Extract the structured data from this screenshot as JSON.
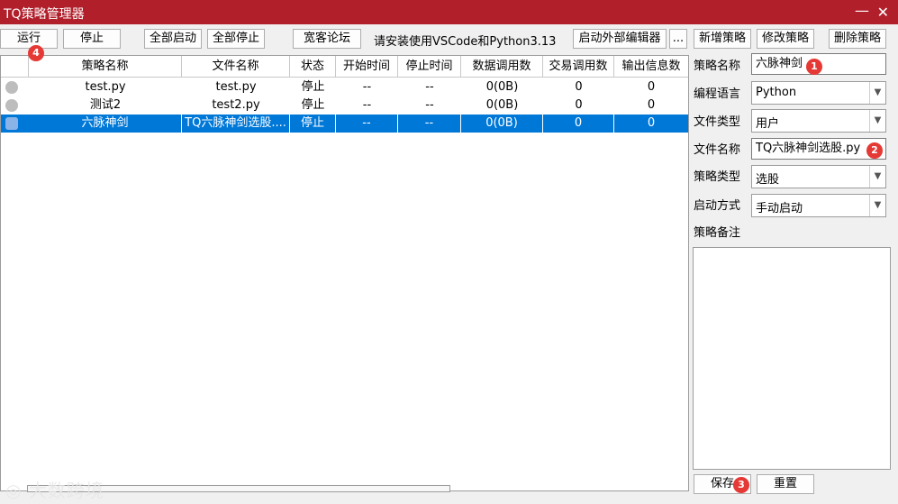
{
  "window": {
    "title": "TQ策略管理器",
    "minimize_glyph": "—",
    "close_glyph": "✕"
  },
  "toolbar": {
    "run": "运行",
    "stop": "停止",
    "start_all": "全部启动",
    "stop_all": "全部停止",
    "forum": "宽客论坛",
    "install_hint": "请安装使用VSCode和Python3.13",
    "launch_editor": "启动外部编辑器",
    "more": "...",
    "add_strategy": "新增策略",
    "modify_strategy": "修改策略",
    "delete_strategy": "删除策略"
  },
  "table": {
    "columns": [
      "策略名称",
      "文件名称",
      "状态",
      "开始时间",
      "停止时间",
      "数据调用数",
      "交易调用数",
      "输出信息数"
    ],
    "rows": [
      [
        "test.py",
        "test.py",
        "停止",
        "--",
        "--",
        "0(0B)",
        "0",
        "0"
      ],
      [
        "测试2",
        "test2.py",
        "停止",
        "--",
        "--",
        "0(0B)",
        "0",
        "0"
      ],
      [
        "六脉神剑",
        "TQ六脉神剑选股....",
        "停止",
        "--",
        "--",
        "0(0B)",
        "0",
        "0"
      ]
    ],
    "selected_row": 2
  },
  "form": {
    "strategy_name_label": "策略名称",
    "strategy_name_value": "六脉神剑",
    "language_label": "编程语言",
    "language_value": "Python",
    "file_type_label": "文件类型",
    "file_type_value": "用户",
    "file_name_label": "文件名称",
    "file_name_value": "TQ六脉神剑选股.py",
    "strategy_type_label": "策略类型",
    "strategy_type_value": "选股",
    "launch_mode_label": "启动方式",
    "launch_mode_value": "手动启动",
    "notes_label": "策略备注",
    "save": "保存",
    "reset": "重置"
  },
  "markers": [
    "1",
    "2",
    "3",
    "4"
  ],
  "watermark": "大数跨境",
  "colors": {
    "titlebar": "#b11f2b",
    "selection": "#0078d7",
    "marker": "#e53935"
  }
}
